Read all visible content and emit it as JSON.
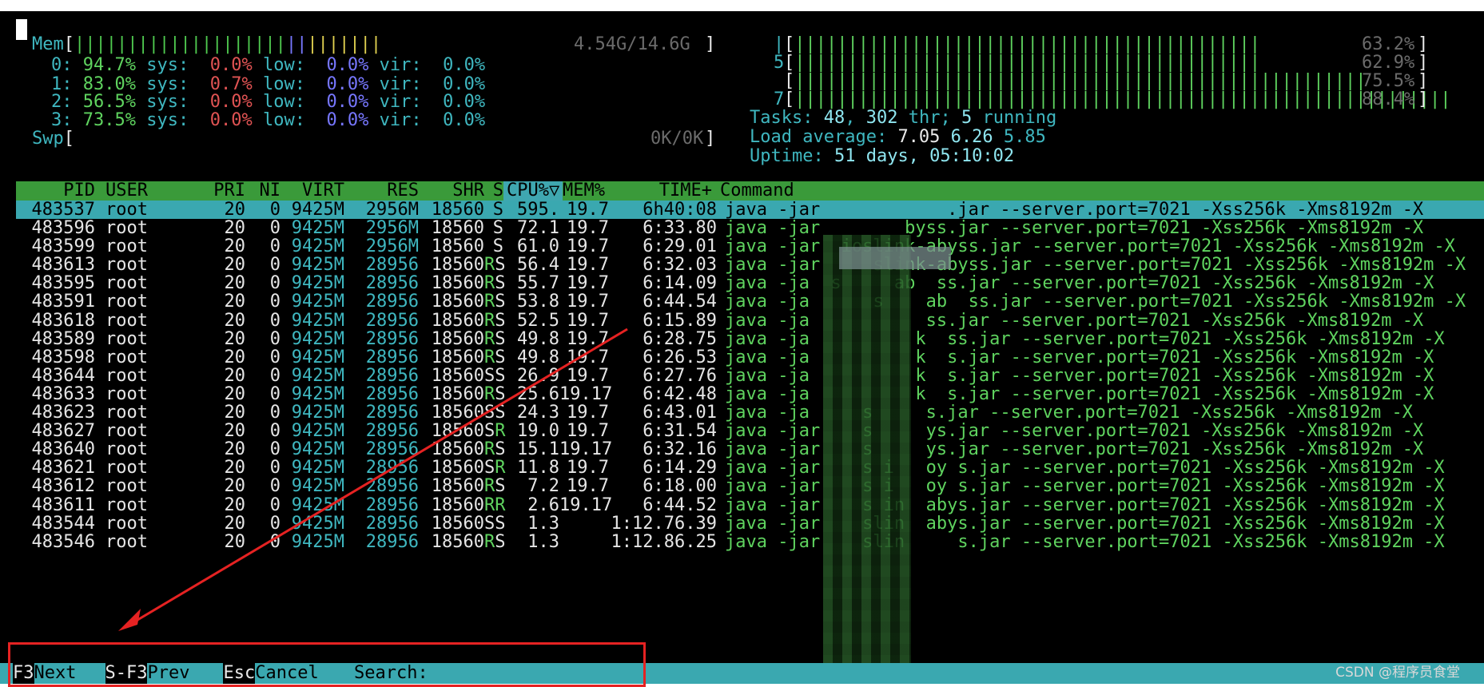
{
  "meters_left": {
    "mem": {
      "label": "Mem",
      "bar_green": "||||||||||||||||||||",
      "bar_blue": "||",
      "bar_yellow": "|||||||",
      "value": "4.54G/14.6G"
    },
    "cpus": [
      {
        "id": "0:",
        "pct": "94.7%",
        "sys_label": "sys:",
        "sys": "0.0%",
        "low_label": "low:",
        "low": "0.0%",
        "vir_label": "vir:",
        "vir": "0.0%"
      },
      {
        "id": "1:",
        "pct": "83.0%",
        "sys_label": "sys:",
        "sys": "0.7%",
        "low_label": "low:",
        "low": "0.0%",
        "vir_label": "vir:",
        "vir": "0.0%"
      },
      {
        "id": "2:",
        "pct": "56.5%",
        "sys_label": "sys:",
        "sys": "0.0%",
        "low_label": "low:",
        "low": "0.0%",
        "vir_label": "vir:",
        "vir": "0.0%"
      },
      {
        "id": "3:",
        "pct": "73.5%",
        "sys_label": "sys:",
        "sys": "0.0%",
        "low_label": "low:",
        "low": "0.0%",
        "vir_label": "vir:",
        "vir": "0.0%"
      }
    ],
    "swp": {
      "label": "Swp",
      "value": "0K/0K"
    }
  },
  "meters_right": {
    "cpu_bars": [
      {
        "id": "|",
        "bar": "||||||||||||||||||||||||||||||||||||||||||||",
        "value": "63.2%"
      },
      {
        "id": "5",
        "bar": "||||||||||||||||||||||||||||||||||||||||||||",
        "value": "62.9%"
      },
      {
        "id": "",
        "bar": "||||||||||||||||||||||||||||||||||||||||||||||||||||||",
        "value": "75.5%"
      },
      {
        "id": "7",
        "bar": "||||||||||||||||||||||||||||||||||||||||||||||||||||||||||||||",
        "value": "88.4%"
      }
    ],
    "tasks": {
      "label": "Tasks:",
      "count": "48",
      "thr": "302",
      "thr_label": "thr;",
      "running": "5",
      "running_label": "running"
    },
    "load": {
      "label": "Load average:",
      "v1": "7.05",
      "v2": "6.26",
      "v3": "5.85"
    },
    "uptime": {
      "label": "Uptime:",
      "value": "51 days, 05:10:02"
    }
  },
  "table": {
    "headers": {
      "pid": "PID",
      "user": "USER",
      "pri": "PRI",
      "ni": "NI",
      "virt": "VIRT",
      "res": "RES",
      "shr": "SHR",
      "s": "S",
      "cpu": "CPU%▽",
      "mem": "MEM%",
      "time": "TIME+",
      "cmd": "Command"
    },
    "rows": [
      {
        "pid": "483537",
        "user": "root",
        "pri": "20",
        "ni": "0",
        "virt": "9425M",
        "res": "2956M",
        "shr": "18560",
        "s": "S",
        "cpu": "595.",
        "mem": "19.7",
        "time": "6h40:08",
        "cmd": "java -jar            .jar --server.port=7021 -Xss256k -Xms8192m -X"
      },
      {
        "pid": "483596",
        "user": "root",
        "pri": "20",
        "ni": "0",
        "virt": "9425M",
        "res": "2956M",
        "shr": "18560",
        "s": "S",
        "cpu": "72.1",
        "mem": "19.7",
        "time": "6:33.80",
        "cmd": "java -jar        byss.jar --server.port=7021 -Xss256k -Xms8192m -X"
      },
      {
        "pid": "483599",
        "user": "root",
        "pri": "20",
        "ni": "0",
        "virt": "9425M",
        "res": "2956M",
        "shr": "18560",
        "s": "S",
        "cpu": "61.0",
        "mem": "19.7",
        "time": "6:29.01",
        "cmd": "java -jar  ioslink-abyss.jar --server.port=7021 -Xss256k -Xms8192m -X"
      },
      {
        "pid": "483613",
        "user": "root",
        "pri": "20",
        "ni": "0",
        "virt": "9425M",
        "res": "28956",
        "shr": "18560",
        "s": "R",
        "s2": "S",
        "cpu": "56.4",
        "mem": "19.7",
        "time": "6:32.03",
        "cmd": "java -jar     slink-abyss.jar --server.port=7021 -Xss256k -Xms8192m -X"
      },
      {
        "pid": "483595",
        "user": "root",
        "pri": "20",
        "ni": "0",
        "virt": "9425M",
        "res": "28956",
        "shr": "18560",
        "s": "R",
        "s2": "S",
        "cpu": "55.7",
        "mem": "19.7",
        "time": "6:14.09",
        "cmd": "java -ja  s     ab  ss.jar --server.port=7021 -Xss256k -Xms8192m -X"
      },
      {
        "pid": "483591",
        "user": "root",
        "pri": "20",
        "ni": "0",
        "virt": "9425M",
        "res": "28956",
        "shr": "18560",
        "s": "R",
        "s2": "S",
        "cpu": "53.8",
        "mem": "19.7",
        "time": "6:44.54",
        "cmd": "java -ja      s    ab  ss.jar --server.port=7021 -Xss256k -Xms8192m -X"
      },
      {
        "pid": "483618",
        "user": "root",
        "pri": "20",
        "ni": "0",
        "virt": "9425M",
        "res": "28956",
        "shr": "18560",
        "s": "R",
        "s2": "S",
        "cpu": "52.5",
        "mem": "19.7",
        "time": "6:15.89",
        "cmd": "java -ja           ss.jar --server.port=7021 -Xss256k -Xms8192m -X"
      },
      {
        "pid": "483589",
        "user": "root",
        "pri": "20",
        "ni": "0",
        "virt": "9425M",
        "res": "28956",
        "shr": "18560",
        "s": "R",
        "s2": "S",
        "cpu": "49.8",
        "mem": "19.7",
        "time": "6:28.75",
        "cmd": "java -ja          k  ss.jar --server.port=7021 -Xss256k -Xms8192m -X"
      },
      {
        "pid": "483598",
        "user": "root",
        "pri": "20",
        "ni": "0",
        "virt": "9425M",
        "res": "28956",
        "shr": "18560",
        "s": "R",
        "s2": "S",
        "cpu": "49.8",
        "mem": "19.7",
        "time": "6:26.53",
        "cmd": "java -ja          k  s.jar --server.port=7021 -Xss256k -Xms8192m -X"
      },
      {
        "pid": "483644",
        "user": "root",
        "pri": "20",
        "ni": "0",
        "virt": "9425M",
        "res": "28956",
        "shr": "18560",
        "s": "S",
        "s2": "S",
        "cpu": "26.9",
        "mem": "19.7",
        "time": "6:27.76",
        "cmd": "java -ja          k  s.jar --server.port=7021 -Xss256k -Xms8192m -X"
      },
      {
        "pid": "483633",
        "user": "root",
        "pri": "20",
        "ni": "0",
        "virt": "9425M",
        "res": "28956",
        "shr": "18560",
        "s": "R",
        "s2": "S",
        "cpu": "25.6",
        "mem": "19.17",
        "time": "6:42.48",
        "cmd": "java -ja          k  s.jar --server.port=7021 -Xss256k -Xms8192m -X"
      },
      {
        "pid": "483623",
        "user": "root",
        "pri": "20",
        "ni": "0",
        "virt": "9425M",
        "res": "28956",
        "shr": "18560",
        "s": "S",
        "s2": "S",
        "cpu": "24.3",
        "mem": "19.7",
        "time": "6:43.01",
        "cmd": "java -ja     s     s.jar --server.port=7021 -Xss256k -Xms8192m -X"
      },
      {
        "pid": "483627",
        "user": "root",
        "pri": "20",
        "ni": "0",
        "virt": "9425M",
        "res": "28956",
        "shr": "18560",
        "s": "S",
        "s2": "R",
        "cpu": "19.0",
        "mem": "19.7",
        "time": "6:31.54",
        "cmd": "java -jar    s     ys.jar --server.port=7021 -Xss256k -Xms8192m -X"
      },
      {
        "pid": "483640",
        "user": "root",
        "pri": "20",
        "ni": "0",
        "virt": "9425M",
        "res": "28956",
        "shr": "18560",
        "s": "R",
        "s2": "S",
        "cpu": "15.1",
        "mem": "19.17",
        "time": "6:32.16",
        "cmd": "java -jar    s     ys.jar --server.port=7021 -Xss256k -Xms8192m -X"
      },
      {
        "pid": "483621",
        "user": "root",
        "pri": "20",
        "ni": "0",
        "virt": "9425M",
        "res": "28956",
        "shr": "18560",
        "s": "S",
        "s2": "R",
        "cpu": "11.8",
        "mem": "19.7",
        "time": "6:14.29",
        "cmd": "java -jar    s i   oy s.jar --server.port=7021 -Xss256k -Xms8192m -X"
      },
      {
        "pid": "483612",
        "user": "root",
        "pri": "20",
        "ni": "0",
        "virt": "9425M",
        "res": "28956",
        "shr": "18560",
        "s": "R",
        "s2": "S",
        "cpu": "7.2",
        "mem": "19.7",
        "time": "6:18.00",
        "cmd": "java -jar    s i   oy s.jar --server.port=7021 -Xss256k -Xms8192m -X"
      },
      {
        "pid": "483611",
        "user": "root",
        "pri": "20",
        "ni": "0",
        "virt": "9425M",
        "res": "28956",
        "shr": "18560",
        "s": "R",
        "s2": "R",
        "cpu": "2.6",
        "mem": "19.17",
        "time": "6:44.52",
        "cmd": "java -jar    s in  abys.jar --server.port=7021 -Xss256k -Xms8192m -X"
      },
      {
        "pid": "483544",
        "user": "root",
        "pri": "20",
        "ni": "0",
        "virt": "9425M",
        "res": "28956",
        "shr": "18560",
        "s": "S",
        "s2": "S",
        "cpu": "1.3",
        "mem": "",
        "time": "1:12.76.39",
        "cmd": "java -jar    slin  abys.jar --server.port=7021 -Xss256k -Xms8192m -X"
      },
      {
        "pid": "483546",
        "user": "root",
        "pri": "20",
        "ni": "0",
        "virt": "9425M",
        "res": "28956",
        "shr": "18560",
        "s": "R",
        "s2": "S",
        "cpu": "1.3",
        "mem": "",
        "time": "1:12.86.25",
        "cmd": "java -jar    slin     s.jar --server.port=7021 -Xss256k -Xms8192m -X"
      }
    ]
  },
  "footer": {
    "next_key": "F3",
    "next_label": "Next",
    "prev_key": "S-F3",
    "prev_label": "Prev",
    "cancel_key": "Esc",
    "cancel_label": "Cancel",
    "search_label": "Search:",
    "search_value": ""
  },
  "watermark": "CSDN @程序员食堂",
  "colors": {
    "header_green": "#3a9a3a",
    "selected_cyan": "#3aa8b0",
    "annotation_red": "#e52222"
  }
}
